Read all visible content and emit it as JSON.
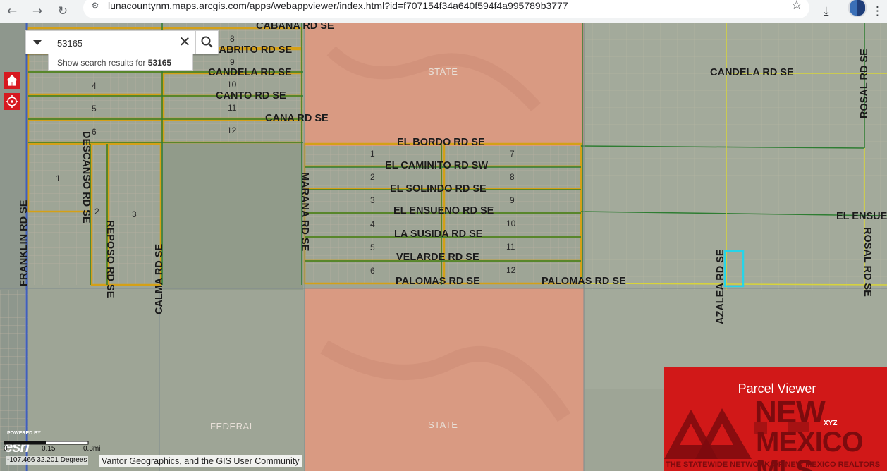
{
  "browser": {
    "url": "lunacountynm.maps.arcgis.com/apps/webappviewer/index.html?id=f707154f34a640f594f4a995789b3777",
    "back_icon": "←",
    "forward_icon": "→",
    "reload_icon": "↻",
    "star_icon": "☆",
    "download_icon": "⤓",
    "menu_icon": "⋮"
  },
  "search": {
    "value": "53165",
    "clear_icon": "✕",
    "suggestion_prefix": "Show search results for",
    "suggestion_term": "53165"
  },
  "map": {
    "street_labels": [
      "CABANA RD SE",
      "CABRITO RD SE",
      "CANDELA RD SE",
      "CANTO RD SE",
      "CANA RD SE",
      "EL BORDO RD SE",
      "EL CAMINITO RD SW",
      "EL SOLINDO RD SE",
      "EL ENSUENO RD SE",
      "LA SUSIDA RD SE",
      "VELARDE RD SE",
      "PALOMAS RD SE",
      "PALOMAS RD SE",
      "CANDELA RD SE",
      "EL ENSUE",
      "FRANKLIN RD SE",
      "DESCANSO RD SE",
      "REPOSO RD SE",
      "CALMA RD SE",
      "MARANA RD SE",
      "AZALEA RD SE",
      "ROSAL RD SE",
      "ROSAL RD SE"
    ],
    "block_numbers": [
      "8",
      "9",
      "10",
      "11",
      "12",
      "4",
      "5",
      "6",
      "1",
      "2",
      "3",
      "4",
      "5",
      "6",
      "7",
      "8",
      "9",
      "10",
      "11",
      "12",
      "1",
      "2",
      "3"
    ],
    "land_labels": [
      "STATE",
      "STATE",
      "FEDERAL"
    ],
    "highlight_color": "#27d4e8",
    "state_color": "#d99a82",
    "parcel_color": "#d4a017"
  },
  "attribution": {
    "credits": "Vantor Geographics, and the GIS User Community",
    "coords": "-107.466 32.201 Degrees",
    "powered_by": "POWERED BY",
    "esri": "esri",
    "scale_labels": [
      "0",
      "0.15",
      "0.3mi"
    ]
  },
  "banner": {
    "title": "Parcel Viewer",
    "logo_line1": "NEW",
    "logo_line2": "MEXICO MLS",
    "logo_tag": "XYZ",
    "tagline": "THE STATEWIDE NETWORK OF NEW MEXICO REALTORS"
  }
}
